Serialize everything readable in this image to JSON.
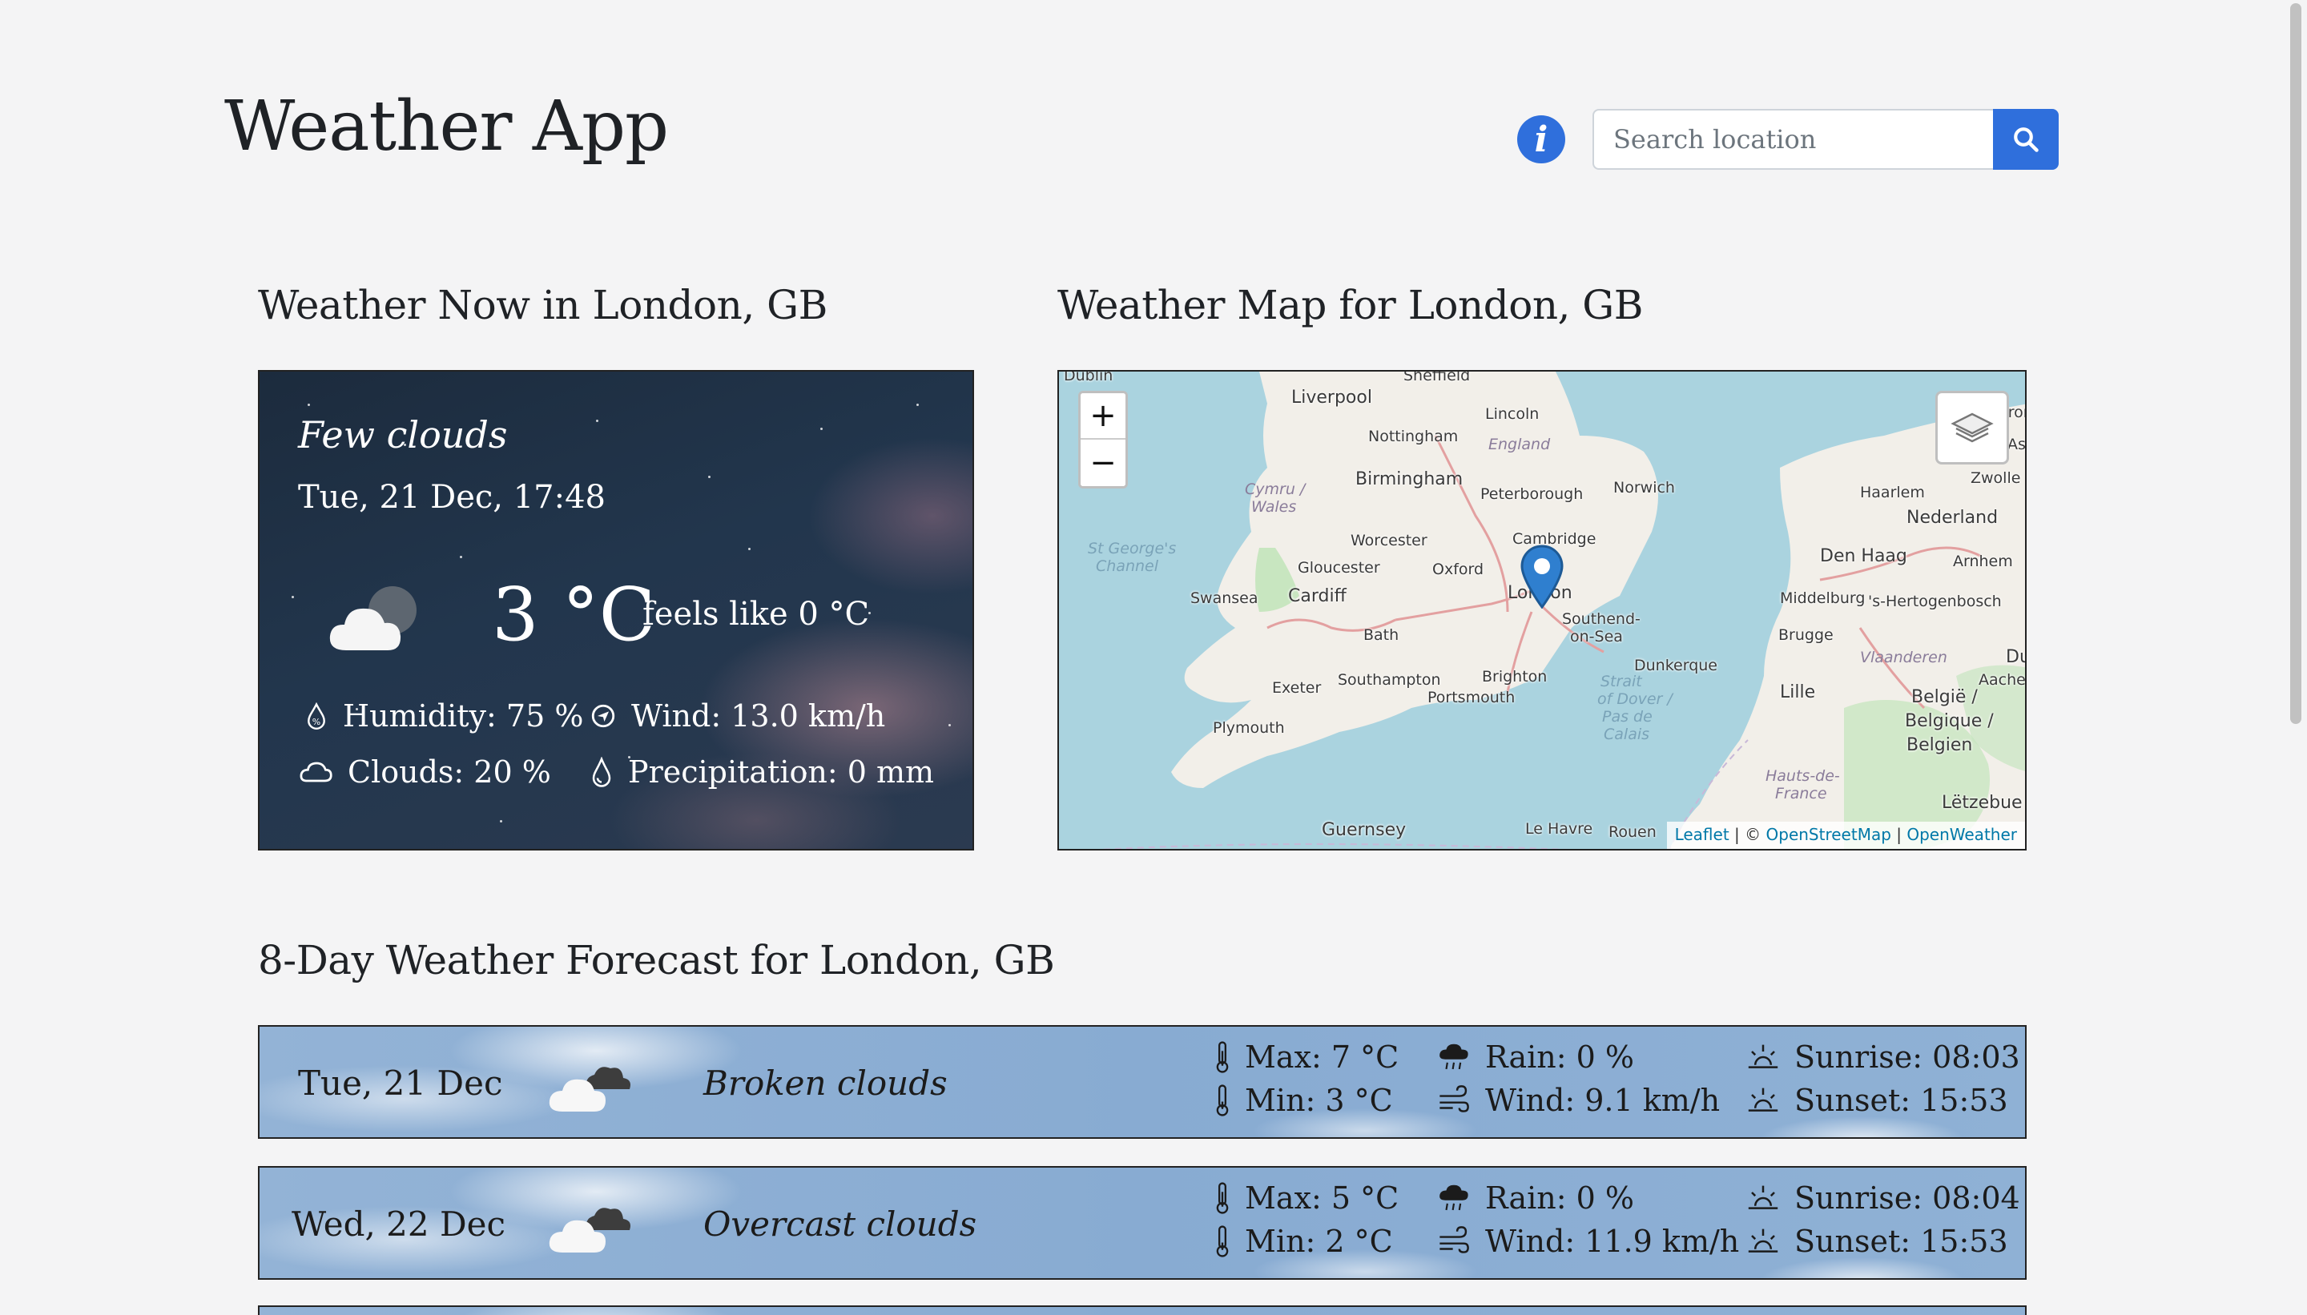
{
  "header": {
    "title": "Weather App",
    "info_label": "i",
    "search_placeholder": "Search location"
  },
  "now": {
    "heading": "Weather Now in London, GB",
    "description": "Few clouds",
    "datetime": "Tue, 21 Dec, 17:48",
    "temperature": "3 °C",
    "feels_like": "feels like 0 °C",
    "humidity": "Humidity: 75 %",
    "wind": "Wind: 13.0 km/h",
    "clouds": "Clouds: 20 %",
    "precipitation": "Precipitation: 0 mm",
    "icon": "few-clouds-night-icon"
  },
  "map": {
    "heading": "Weather Map for London, GB",
    "zoom_in": "+",
    "zoom_out": "−",
    "attribution": {
      "leaflet": "Leaflet",
      "sep1": " | © ",
      "osm": "OpenStreetMap",
      "sep2": " | ",
      "ow": "OpenWeather"
    },
    "labels": {
      "dublin": "Dublin",
      "sheffield": "Sheffield",
      "liverpool": "Liverpool",
      "lincoln": "Lincoln",
      "nottingham": "Nottingham",
      "england": "England",
      "cymru": "Cymru /",
      "wales": "Wales",
      "birmingham": "Birmingham",
      "peterborough": "Peterborough",
      "norwich": "Norwich",
      "haarlem": "Haarlem",
      "zwolle": "Zwolle",
      "nederland": "Nederland",
      "st_georges": "St George's",
      "channel": "Channel",
      "worcester": "Worcester",
      "cambridge": "Cambridge",
      "gloucester": "Gloucester",
      "oxford": "Oxford",
      "den_haag": "Den Haag",
      "arnhem": "Arnhem",
      "swansea": "Swansea",
      "cardiff": "Cardiff",
      "london": "London",
      "middelburg": "Middelburg",
      "hertogenbosch": "'s-Hertogenbosch",
      "southend": "Southend-",
      "on_sea": "on-Sea",
      "bath": "Bath",
      "brugge": "Brugge",
      "dunkerque": "Dunkerque",
      "vlaanderen": "Vlaanderen",
      "southampton": "Southampton",
      "brighton": "Brighton",
      "exeter": "Exeter",
      "portsmouth": "Portsmouth",
      "strait": "Strait",
      "of_dover": "of Dover /",
      "pas_de": "Pas de",
      "calais": "Calais",
      "lille": "Lille",
      "belgie": "België /",
      "belgique": "Belgique /",
      "belgien": "Belgien",
      "aachen": "Aachen",
      "plymouth": "Plymouth",
      "hauts": "Hauts-de-",
      "france": "France",
      "letzebu": "Lëtzebue",
      "guernsey": "Guernsey",
      "le_havre": "Le Havre",
      "rouen": "Rouen",
      "gron": "Gron",
      "as": "As",
      "dus": "Dus"
    }
  },
  "forecast": {
    "heading": "8-Day Weather Forecast for London, GB",
    "days": [
      {
        "date": "Tue, 21 Dec",
        "description": "Broken clouds",
        "max": "Max: 7 °C",
        "min": "Min: 3 °C",
        "rain": "Rain: 0 %",
        "wind": "Wind: 9.1 km/h",
        "sunrise": "Sunrise: 08:03",
        "sunset": "Sunset: 15:53"
      },
      {
        "date": "Wed, 22 Dec",
        "description": "Overcast clouds",
        "max": "Max: 5 °C",
        "min": "Min: 2 °C",
        "rain": "Rain: 0 %",
        "wind": "Wind: 11.9 km/h",
        "sunrise": "Sunrise: 08:04",
        "sunset": "Sunset: 15:53"
      }
    ]
  },
  "colors": {
    "accent": "#2f6fdc",
    "background": "#f4f4f5"
  }
}
